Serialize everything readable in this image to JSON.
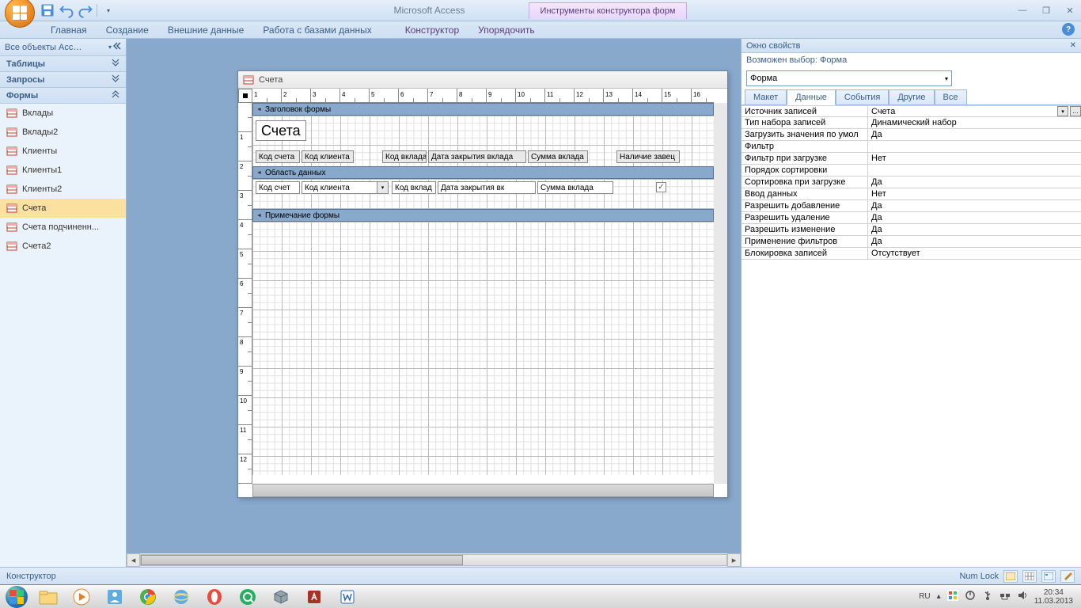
{
  "title_bar": {
    "app_name": "Microsoft Access",
    "tool_tab_group": "Инструменты конструктора форм"
  },
  "ribbon_tabs": [
    "Главная",
    "Создание",
    "Внешние данные",
    "Работа с базами данных",
    "Конструктор",
    "Упорядочить"
  ],
  "nav": {
    "header": "Все объекты Acc…",
    "groups": {
      "tables": "Таблицы",
      "queries": "Запросы",
      "forms": "Формы"
    },
    "form_items": [
      "Вклады",
      "Вклады2",
      "Клиенты",
      "Клиенты1",
      "Клиенты2",
      "Счета",
      "Счета подчиненн...",
      "Счета2"
    ],
    "selected": "Счета"
  },
  "form_window": {
    "title": "Счета",
    "sections": {
      "header": "Заголовок формы",
      "detail": "Область данных",
      "footer": "Примечание формы"
    },
    "title_label": "Счета",
    "header_labels": [
      "Код счета",
      "Код клиента",
      "Код вклада",
      "Дата закрытия вклада",
      "Сумма вклада",
      "Наличие завец"
    ],
    "detail_fields": [
      "Код счет",
      "Код клиента",
      "Код вклад",
      "Дата закрытия вк",
      "Сумма вклада"
    ]
  },
  "props": {
    "title": "Окно свойств",
    "subtitle_label": "Возможен выбор:",
    "subtitle_value": "Форма",
    "selector": "Форма",
    "tabs": [
      "Макет",
      "Данные",
      "События",
      "Другие",
      "Все"
    ],
    "active_tab": "Данные",
    "rows": [
      {
        "n": "Источник записей",
        "v": "Счета",
        "btns": true
      },
      {
        "n": "Тип набора записей",
        "v": "Динамический набор"
      },
      {
        "n": "Загрузить значения по умол",
        "v": "Да"
      },
      {
        "n": "Фильтр",
        "v": ""
      },
      {
        "n": "Фильтр при загрузке",
        "v": "Нет"
      },
      {
        "n": "Порядок сортировки",
        "v": ""
      },
      {
        "n": "Сортировка при загрузке",
        "v": "Да"
      },
      {
        "n": "Ввод данных",
        "v": "Нет"
      },
      {
        "n": "Разрешить добавление",
        "v": "Да"
      },
      {
        "n": "Разрешить удаление",
        "v": "Да"
      },
      {
        "n": "Разрешить изменение",
        "v": "Да"
      },
      {
        "n": "Применение фильтров",
        "v": "Да"
      },
      {
        "n": "Блокировка записей",
        "v": "Отсутствует"
      }
    ]
  },
  "status": {
    "mode": "Конструктор",
    "numlock": "Num Lock"
  },
  "taskbar": {
    "lang": "RU",
    "time": "20:34",
    "date": "11.03.2013"
  }
}
